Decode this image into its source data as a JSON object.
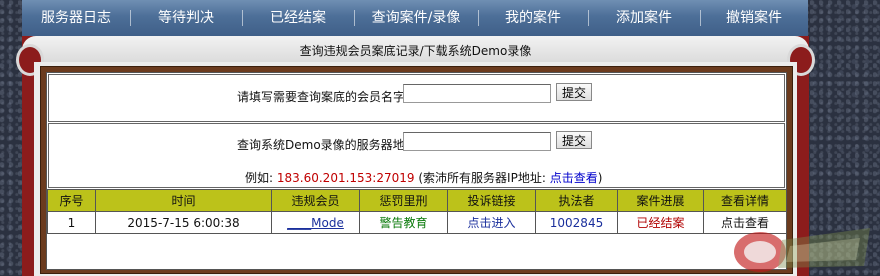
{
  "nav": {
    "items": [
      {
        "label": "服务器日志"
      },
      {
        "label": "等待判决"
      },
      {
        "label": "已经结案"
      },
      {
        "label": "查询案件/录像"
      },
      {
        "label": "我的案件"
      },
      {
        "label": "添加案件"
      },
      {
        "label": "撤销案件"
      }
    ]
  },
  "panel": {
    "title": "查询违规会员案底记录/下载系统Demo录像"
  },
  "member_search": {
    "label": "请填写需要查询案底的会员名字",
    "value": "",
    "button": "提交"
  },
  "demo_search": {
    "label": "查询系统Demo录像的服务器地址",
    "value": "",
    "button": "提交",
    "example_prefix": "例如:",
    "example_ip": "183.60.201.153:27019",
    "example_mid": "(索沛所有服务器IP地址:",
    "example_link": "点击查看",
    "example_suffix": ")"
  },
  "table": {
    "headers": [
      "序号",
      "时间",
      "违规会员",
      "惩罚里刑",
      "投诉链接",
      "执法者",
      "案件进展",
      "查看详情"
    ],
    "rows": [
      {
        "no": "1",
        "time": "2015-7-15 6:00:38",
        "member": "____Mode",
        "penalty": "警告教育",
        "complaint": "点击进入",
        "enforcer": "1002845",
        "progress": "已经结案",
        "detail": "点击查看"
      }
    ]
  },
  "colors": {
    "nav_bg": "#4d6f98",
    "panel_red": "#8c1c1c",
    "header_olive": "#bcc21a",
    "link_blue": "#0000cc",
    "status_red": "#b00000",
    "penalty_green": "#0a7a0a"
  }
}
